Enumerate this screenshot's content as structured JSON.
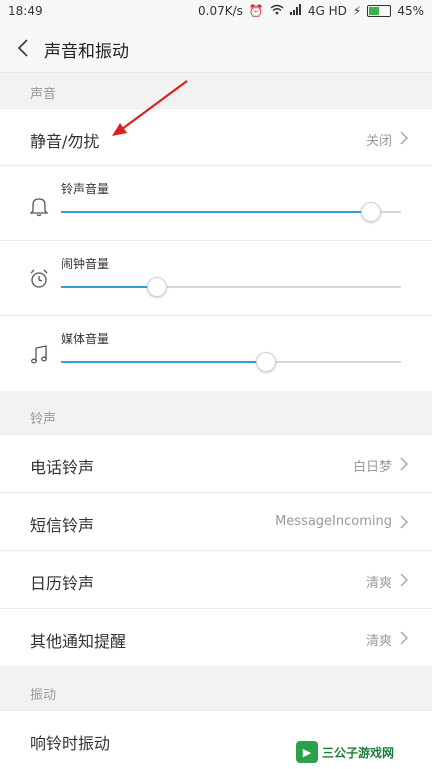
{
  "status_bar": {
    "time": "18:49",
    "speed": "0.07K/s",
    "network": "4G HD",
    "battery": "45%",
    "battery_level": 0.45
  },
  "header": {
    "title": "声音和振动"
  },
  "sections": {
    "sound": "声音",
    "ringtone": "铃声",
    "vibration": "振动"
  },
  "silent_row": {
    "label": "静音/勿扰",
    "value": "关闭"
  },
  "volumes": [
    {
      "label": "铃声音量",
      "icon": "bell-icon",
      "level": 0.91
    },
    {
      "label": "闹钟音量",
      "icon": "alarm-clock-icon",
      "level": 0.28
    },
    {
      "label": "媒体音量",
      "icon": "music-note-icon",
      "level": 0.6
    }
  ],
  "ringtones": [
    {
      "label": "电话铃声",
      "value": "白日梦"
    },
    {
      "label": "短信铃声",
      "value": "MessageIncoming"
    },
    {
      "label": "日历铃声",
      "value": "清爽"
    },
    {
      "label": "其他通知提醒",
      "value": "清爽"
    }
  ],
  "vibration_row": {
    "label": "响铃时振动"
  },
  "watermark": {
    "text": "三公子游戏网",
    "url": "www.sangongzi.net"
  },
  "colors": {
    "accent": "#2f9ddf",
    "annotation_arrow": "#e02020"
  }
}
